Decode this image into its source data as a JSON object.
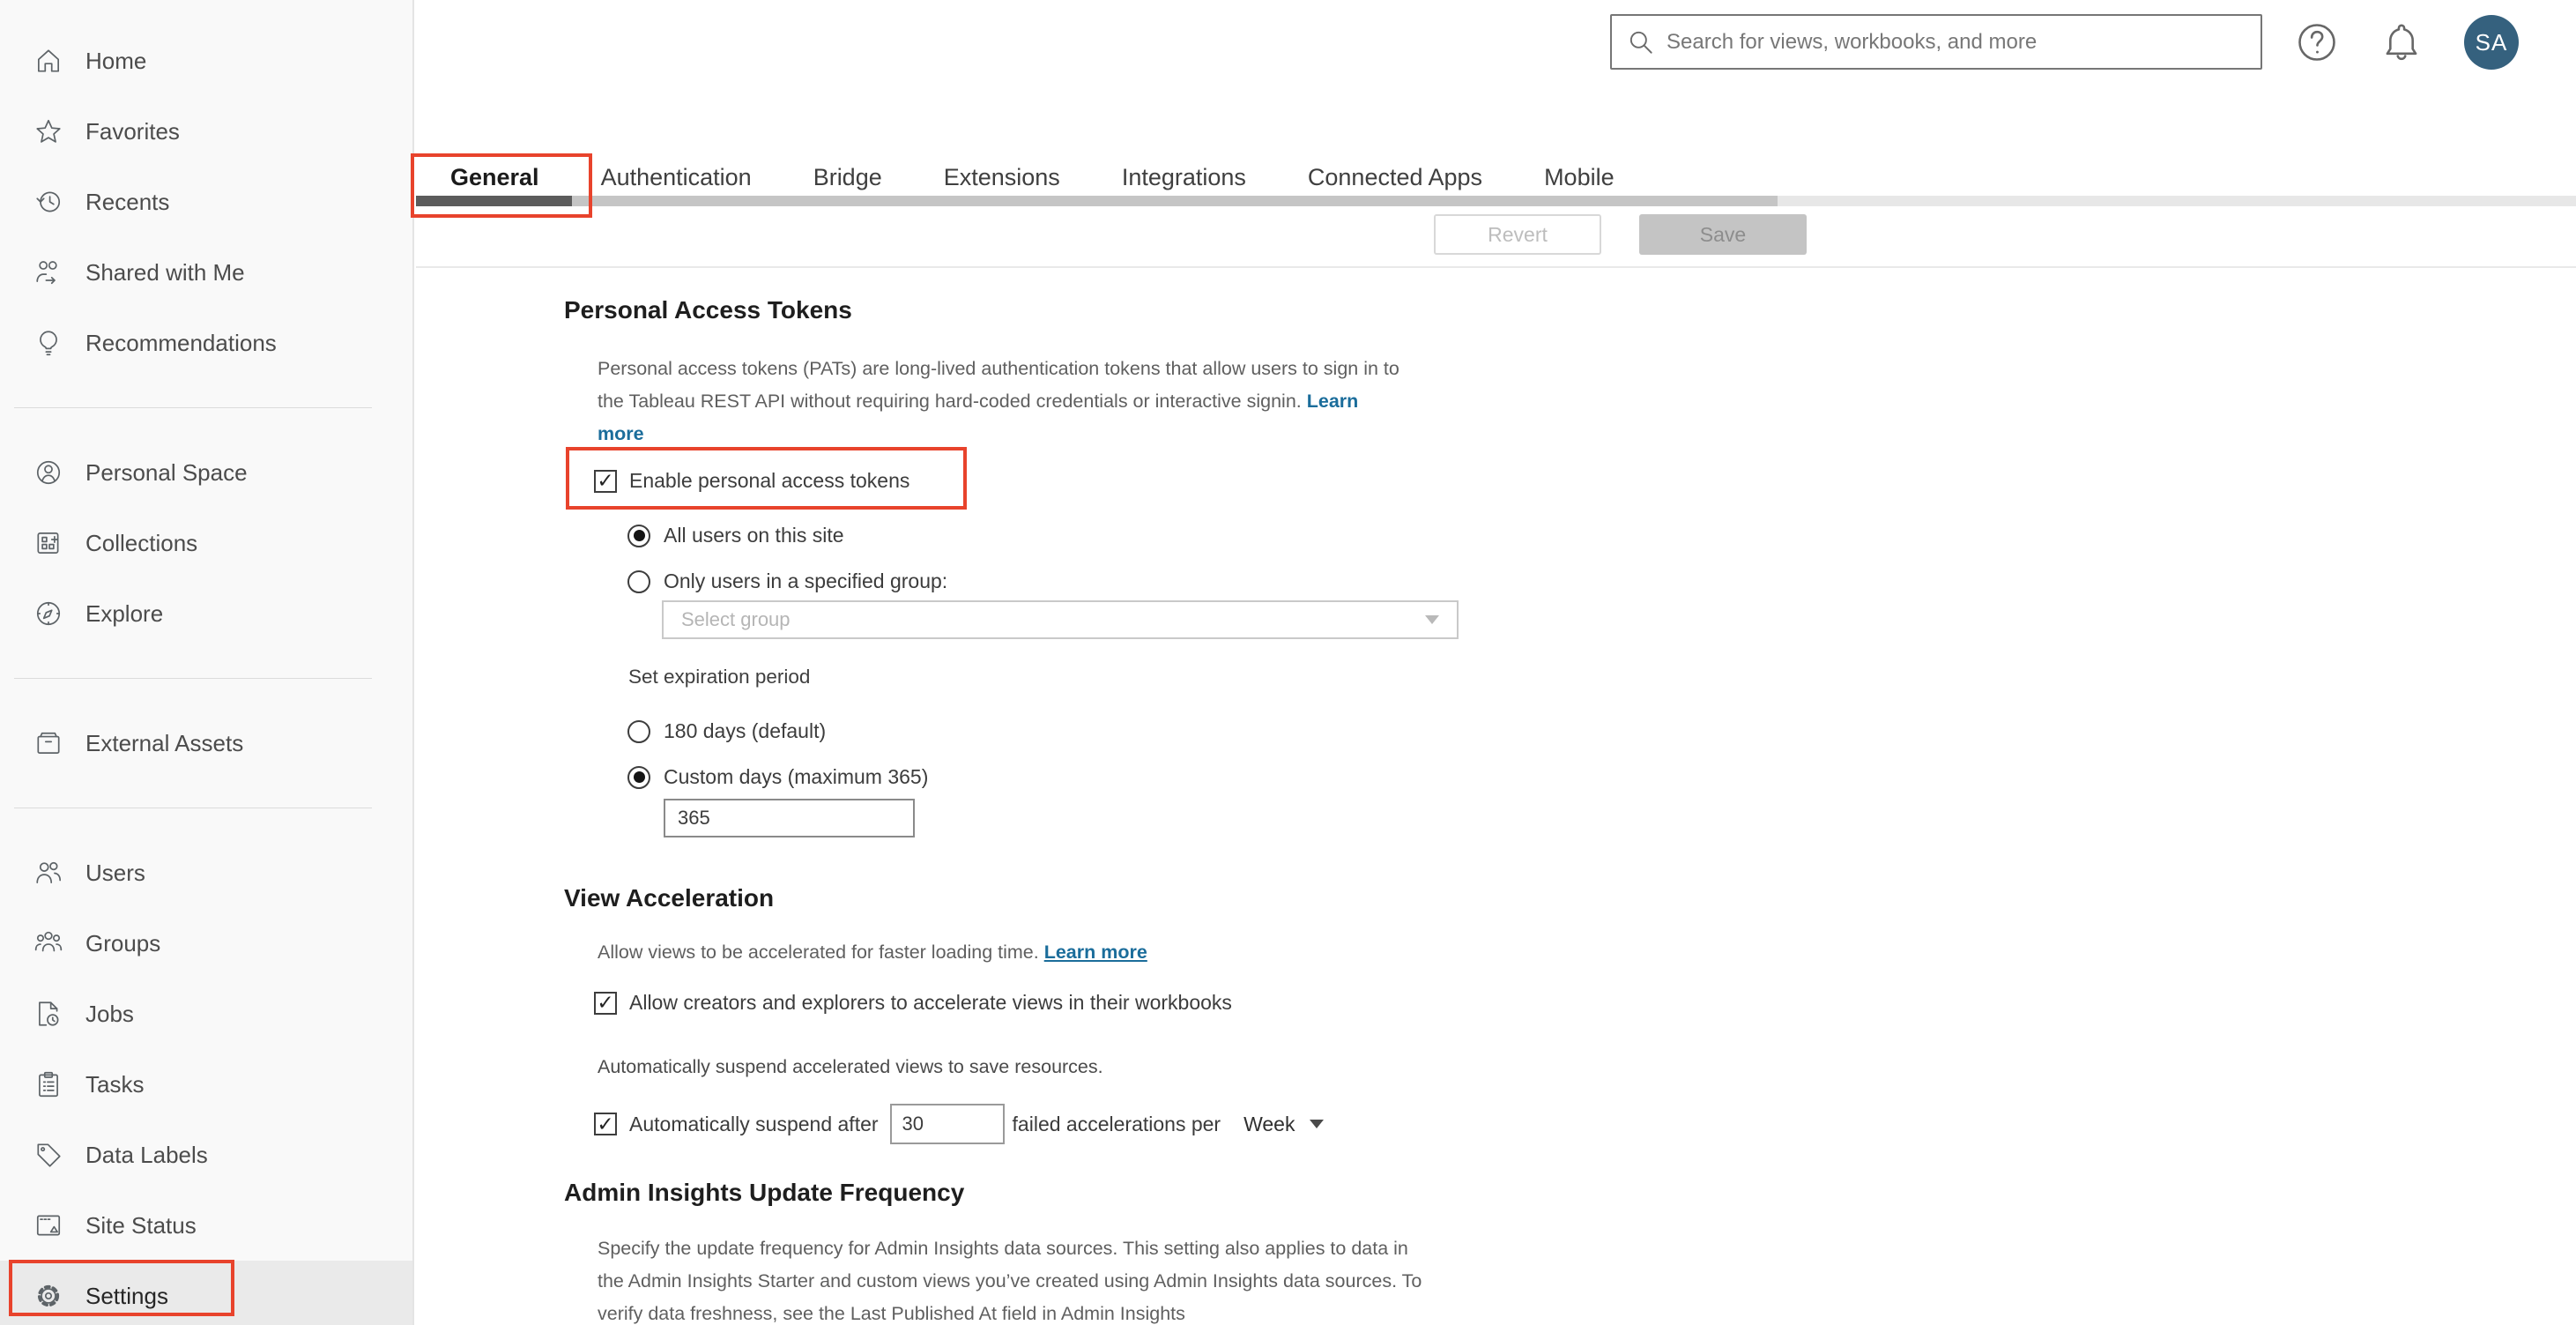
{
  "colors": {
    "accent_red": "#e8432c",
    "link_blue": "#1b6d9b",
    "avatar_bg": "#35617e"
  },
  "topbar": {
    "search_placeholder": "Search for views, workbooks, and more",
    "avatar_initials": "SA",
    "icons": {
      "search": "search-icon",
      "help": "help-icon",
      "notifications": "bell-icon"
    }
  },
  "sidebar": {
    "items": [
      {
        "id": "home",
        "label": "Home",
        "icon": "home-icon"
      },
      {
        "id": "favorites",
        "label": "Favorites",
        "icon": "favorites-icon"
      },
      {
        "id": "recents",
        "label": "Recents",
        "icon": "recents-icon"
      },
      {
        "id": "shared-with-me",
        "label": "Shared with Me",
        "icon": "shared-with-me-icon"
      },
      {
        "id": "recommendations",
        "label": "Recommendations",
        "icon": "recommendations-icon",
        "divider_after": true
      },
      {
        "id": "personal-space",
        "label": "Personal Space",
        "icon": "personal-space-icon"
      },
      {
        "id": "collections",
        "label": "Collections",
        "icon": "collections-icon"
      },
      {
        "id": "explore",
        "label": "Explore",
        "icon": "explore-icon",
        "divider_after": true
      },
      {
        "id": "external-assets",
        "label": "External Assets",
        "icon": "external-assets-icon",
        "divider_after": true
      },
      {
        "id": "users",
        "label": "Users",
        "icon": "users-icon"
      },
      {
        "id": "groups",
        "label": "Groups",
        "icon": "groups-icon"
      },
      {
        "id": "jobs",
        "label": "Jobs",
        "icon": "jobs-icon"
      },
      {
        "id": "tasks",
        "label": "Tasks",
        "icon": "tasks-icon"
      },
      {
        "id": "data-labels",
        "label": "Data Labels",
        "icon": "data-labels-icon"
      },
      {
        "id": "site-status",
        "label": "Site Status",
        "icon": "site-status-icon"
      },
      {
        "id": "settings",
        "label": "Settings",
        "icon": "settings-icon",
        "selected": true,
        "highlighted": true
      }
    ]
  },
  "tabs": {
    "items": [
      {
        "id": "general",
        "label": "General",
        "active": true,
        "highlighted": true
      },
      {
        "id": "authentication",
        "label": "Authentication"
      },
      {
        "id": "bridge",
        "label": "Bridge"
      },
      {
        "id": "extensions",
        "label": "Extensions"
      },
      {
        "id": "integrations",
        "label": "Integrations"
      },
      {
        "id": "connected-apps",
        "label": "Connected Apps"
      },
      {
        "id": "mobile",
        "label": "Mobile"
      }
    ]
  },
  "toolbar": {
    "revert_label": "Revert",
    "save_label": "Save"
  },
  "content": {
    "pat": {
      "title": "Personal Access Tokens",
      "description": "Personal access tokens (PATs) are long-lived authentication tokens that allow users to sign in to the Tableau REST API without requiring hard-coded credentials or interactive signin.",
      "learn_more": "Learn more",
      "enable_label": "Enable personal access tokens",
      "radio_all_users": "All users on this site",
      "radio_group": "Only users in a specified group:",
      "group_placeholder": "Select group",
      "expiration_label": "Set expiration period",
      "radio_180": "180 days (default)",
      "radio_custom": "Custom days (maximum 365)",
      "custom_days_value": "365"
    },
    "view_acceleration": {
      "title": "View Acceleration",
      "description": "Allow views to be accelerated for faster loading time.",
      "learn_more": "Learn more",
      "allow_label": "Allow creators and explorers to accelerate views in their workbooks",
      "suspend_intro": "Automatically suspend accelerated views to save resources.",
      "suspend_before": "Automatically suspend after",
      "suspend_value": "30",
      "suspend_after": "failed accelerations per",
      "suspend_period": "Week"
    },
    "admin_insights": {
      "title": "Admin Insights Update Frequency",
      "description": "Specify the update frequency for Admin Insights data sources. This setting also applies to data in the Admin Insights Starter and custom views you’ve created using Admin Insights data sources. To verify data freshness, see the Last Published At field in Admin Insights"
    }
  }
}
